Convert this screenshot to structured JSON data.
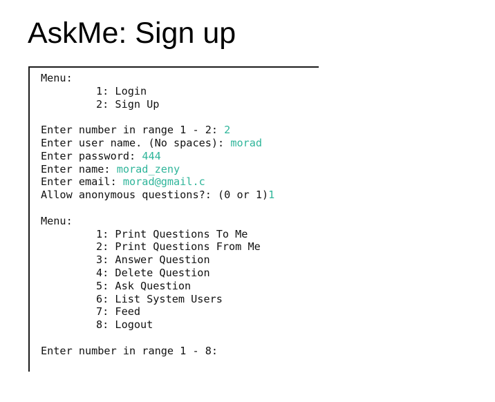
{
  "slide": {
    "title": "AskMe: Sign up"
  },
  "terminal": {
    "menu1_header": "Menu:",
    "menu1_items": [
      "1: Login",
      "2: Sign Up"
    ],
    "prompts": [
      {
        "label": "Enter number in range 1 - 2: ",
        "value": "2"
      },
      {
        "label": "Enter user name. (No spaces): ",
        "value": "morad"
      },
      {
        "label": "Enter password: ",
        "value": "444"
      },
      {
        "label": "Enter name: ",
        "value": "morad_zeny"
      },
      {
        "label": "Enter email: ",
        "value": "morad@gmail.c"
      },
      {
        "label": "Allow anonymous questions?: (0 or 1)",
        "value": "1"
      }
    ],
    "menu2_header": "Menu:",
    "menu2_items": [
      "1: Print Questions To Me",
      "2: Print Questions From Me",
      "3: Answer Question",
      "4: Delete Question",
      "5: Ask Question",
      "6: List System Users",
      "7: Feed",
      "8: Logout"
    ],
    "final_prompt": "Enter number in range 1 - 8:"
  },
  "colors": {
    "input_text": "#2fb59a",
    "terminal_text": "#111111"
  }
}
